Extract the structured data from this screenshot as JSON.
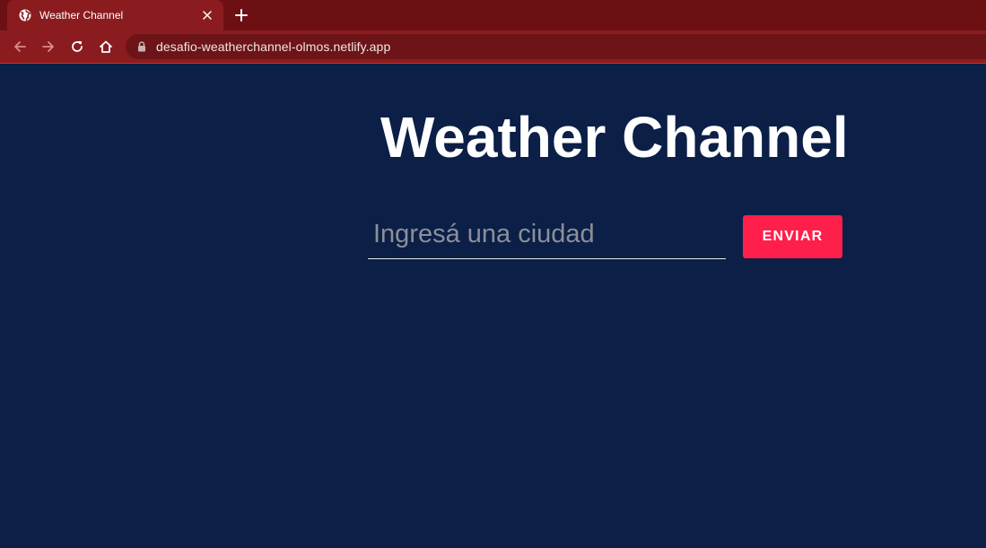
{
  "browser": {
    "tab": {
      "title": "Weather Channel",
      "favicon": "globe-icon"
    },
    "address_bar": {
      "url": "desafio-weatherchannel-olmos.netlify.app"
    },
    "colors": {
      "tabstrip": "#6d1014",
      "toolbar": "#8a1c1f"
    }
  },
  "page": {
    "title": "Weather Channel",
    "search": {
      "placeholder": "Ingresá una ciudad",
      "value": ""
    },
    "submit_label": "ENVIAR",
    "colors": {
      "background": "#0b1f47",
      "accent": "#ff1f4b",
      "text": "#ffffff"
    }
  }
}
